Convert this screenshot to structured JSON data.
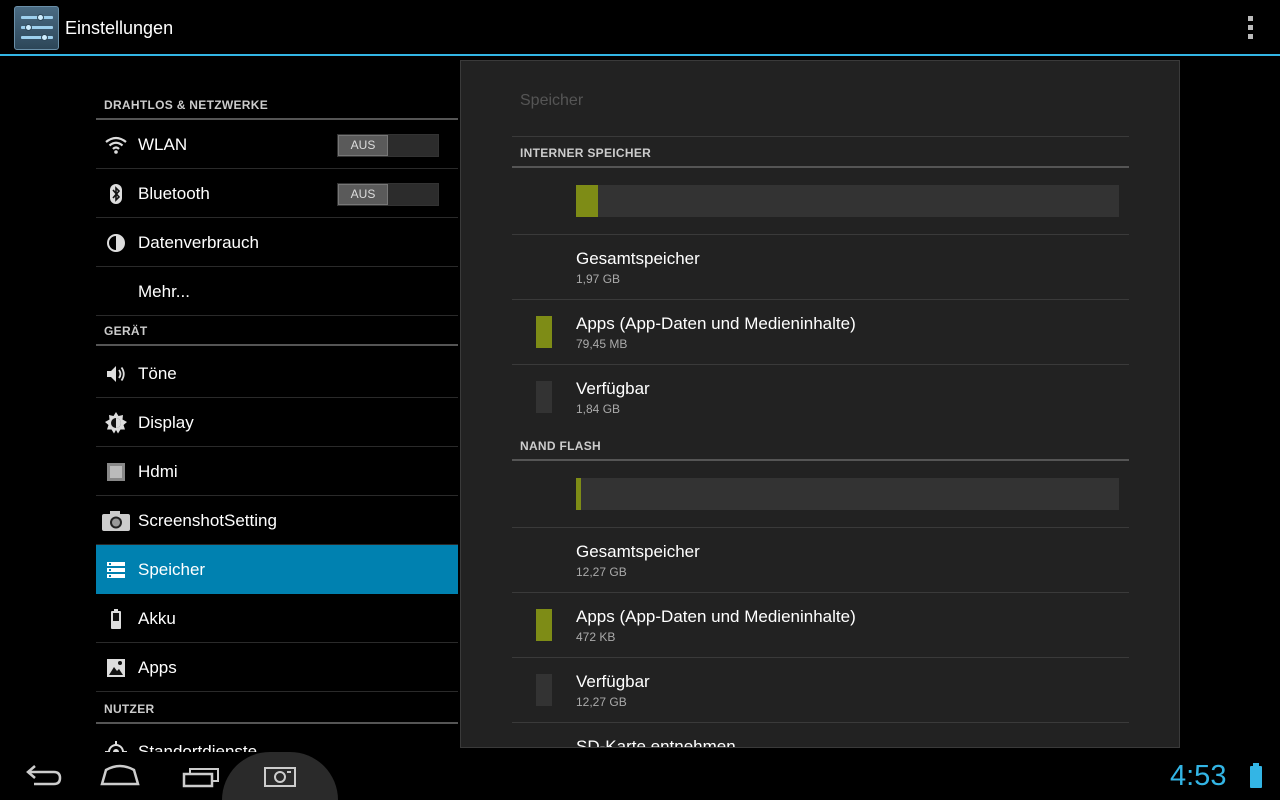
{
  "app": {
    "title": "Einstellungen"
  },
  "sections": {
    "wireless": "DRAHTLOS & NETZWERKE",
    "device": "GERÄT",
    "user": "NUTZER"
  },
  "items": [
    {
      "label": "WLAN",
      "icon": "wifi-icon",
      "toggle": "AUS"
    },
    {
      "label": "Bluetooth",
      "icon": "bluetooth-icon",
      "toggle": "AUS"
    },
    {
      "label": "Datenverbrauch",
      "icon": "data-usage-icon"
    },
    {
      "label": "Mehr...",
      "icon": ""
    },
    {
      "label": "Töne",
      "icon": "speaker-icon"
    },
    {
      "label": "Display",
      "icon": "brightness-icon"
    },
    {
      "label": "Hdmi",
      "icon": "hdmi-icon"
    },
    {
      "label": "ScreenshotSetting",
      "icon": "camera-icon"
    },
    {
      "label": "Speicher",
      "icon": "storage-icon",
      "selected": true
    },
    {
      "label": "Akku",
      "icon": "battery-icon"
    },
    {
      "label": "Apps",
      "icon": "apps-icon"
    },
    {
      "label": "Standortdienste",
      "icon": "location-icon"
    }
  ],
  "panel": {
    "title": "Speicher",
    "internal": {
      "header": "INTERNER SPEICHER",
      "usage_fraction": 0.04,
      "total_label": "Gesamtspeicher",
      "total_value": "1,97 GB",
      "apps_label": "Apps (App-Daten und Medieninhalte)",
      "apps_value": "79,45 MB",
      "free_label": "Verfügbar",
      "free_value": "1,84 GB"
    },
    "nand": {
      "header": "NAND FLASH",
      "usage_fraction": 0.01,
      "total_label": "Gesamtspeicher",
      "total_value": "12,27 GB",
      "apps_label": "Apps (App-Daten und Medieninhalte)",
      "apps_value": "472 KB",
      "free_label": "Verfügbar",
      "free_value": "12,27 GB"
    },
    "next_item": "SD-Karte entnehmen"
  },
  "colors": {
    "accent": "#33b5e5",
    "selected": "#0081b0",
    "apps_swatch": "#7e8c16",
    "free_swatch": "#333333"
  },
  "status": {
    "time": "4:53"
  }
}
